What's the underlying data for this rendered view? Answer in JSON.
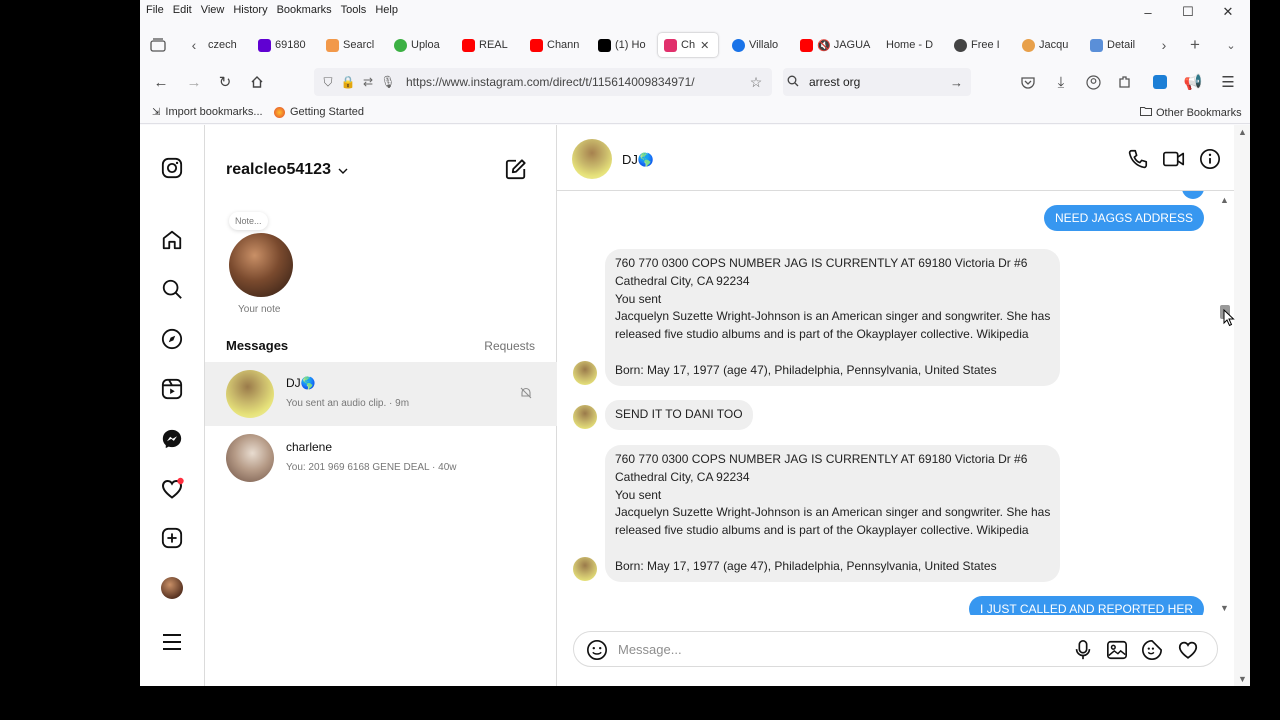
{
  "menu": [
    "File",
    "Edit",
    "View",
    "History",
    "Bookmarks",
    "Tools",
    "Help"
  ],
  "window_controls": {
    "minimize": "–",
    "maximize": "☐",
    "close": "✕"
  },
  "tabs": [
    {
      "label": "czech",
      "color": "#ffffff"
    },
    {
      "label": "69180",
      "color": "#6001d2"
    },
    {
      "label": "Searcl",
      "color": "#f2994a"
    },
    {
      "label": "Uploa",
      "color": "#3cb043"
    },
    {
      "label": "REAL",
      "color": "#ff0000"
    },
    {
      "label": "Chann",
      "color": "#ff0000"
    },
    {
      "label": "(1) Ho",
      "color": "#000000"
    },
    {
      "label": "Ch",
      "color": "#e1306c"
    },
    {
      "label": "Villalo",
      "color": "#1a73e8"
    },
    {
      "label": "JAGUA",
      "color": "#ff0000"
    },
    {
      "label": "Home - D",
      "color": "#cccccc"
    },
    {
      "label": "Free I",
      "color": "#444444"
    },
    {
      "label": "Jacqu",
      "color": "#e8a04a"
    },
    {
      "label": "Detail",
      "color": "#5a8fd8"
    }
  ],
  "url": "https://www.instagram.com/direct/t/115614009834971/",
  "search_value": "arrest org",
  "bookmarks": {
    "import": "Import bookmarks...",
    "getting_started": "Getting Started",
    "other": "Other Bookmarks"
  },
  "account": {
    "username": "realcleo54123"
  },
  "note": {
    "bubble": "Note...",
    "caption": "Your note"
  },
  "messages_header": "Messages",
  "requests_label": "Requests",
  "conversations": [
    {
      "name": "DJ🌎",
      "preview": "You sent an audio clip. · 9m"
    },
    {
      "name": "charlene",
      "preview": "You: 201 969 6168 GENE DEAL · 40w"
    }
  ],
  "thread": {
    "name": "DJ🌎",
    "messages": [
      {
        "dir": "out",
        "text": "NEED JAGGS ADDRESS"
      },
      {
        "dir": "in",
        "text": "760 770 0300 COPS NUMBER JAG IS CURRENTLY AT 69180 Victoria Dr #6\nCathedral City, CA 92234\nYou sent\nJacquelyn Suzette Wright-Johnson is an American singer and songwriter. She has\nreleased five studio albums and is part of the Okayplayer collective. Wikipedia\n\nBorn: May 17, 1977 (age 47), Philadelphia, Pennsylvania, United States"
      },
      {
        "dir": "in",
        "text": "SEND IT TO DANI TOO"
      },
      {
        "dir": "in",
        "text": "760 770 0300 COPS NUMBER JAG IS CURRENTLY AT 69180 Victoria Dr #6\nCathedral City, CA 92234\nYou sent\nJacquelyn Suzette Wright-Johnson is an American singer and songwriter. She has\nreleased five studio albums and is part of the Okayplayer collective. Wikipedia\n\nBorn: May 17, 1977 (age 47), Philadelphia, Pennsylvania, United States"
      },
      {
        "dir": "out",
        "text": "I JUST CALLED AND REPORTED HER"
      }
    ]
  },
  "composer": {
    "placeholder": "Message..."
  },
  "colors": {
    "accent": "#3797f0",
    "bubble_in": "#efefef",
    "notification": "#ff3040"
  }
}
